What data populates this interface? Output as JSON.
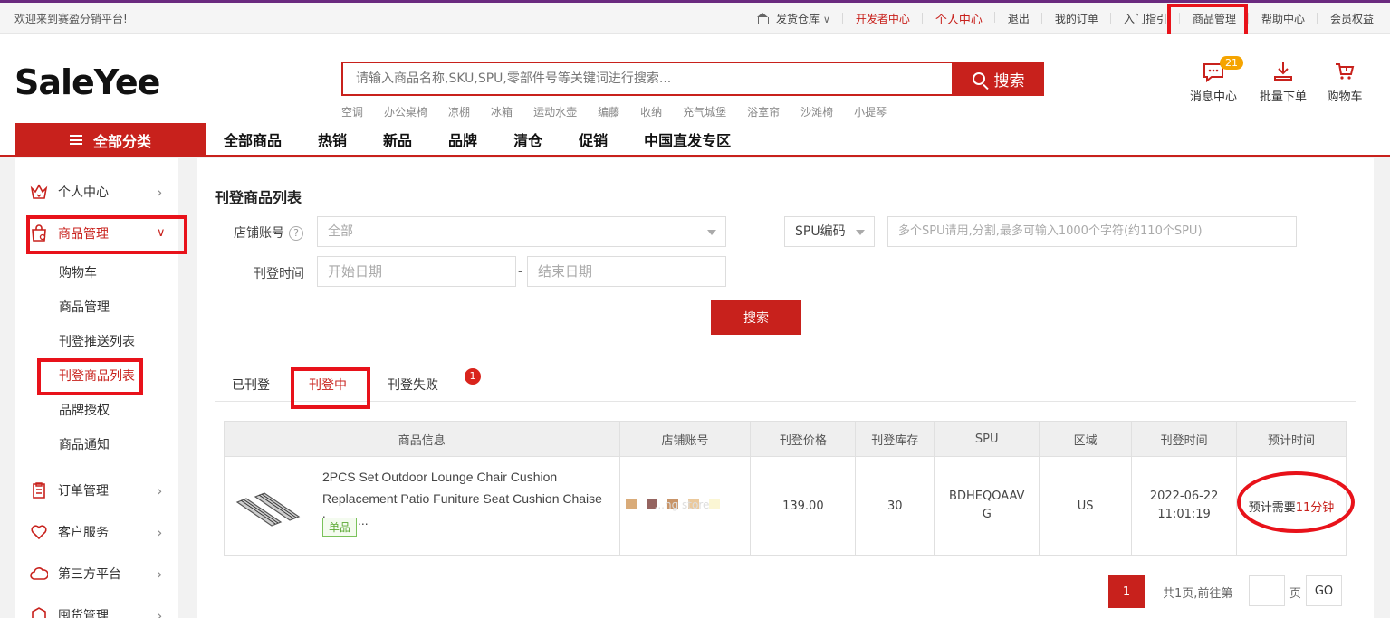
{
  "topbar": {
    "welcome": "欢迎来到赛盈分销平台!",
    "warehouse": "发货仓库",
    "links": [
      "开发者中心",
      "个人中心",
      "退出",
      "我的订单",
      "入门指引",
      "商品管理",
      "帮助中心",
      "会员权益"
    ]
  },
  "header": {
    "logo": "SaleYee",
    "search_placeholder": "请输入商品名称,SKU,SPU,零部件号等关键词进行搜索...",
    "search_button": "搜索",
    "hot_words": [
      "空调",
      "办公桌椅",
      "凉棚",
      "冰箱",
      "运动水壶",
      "编藤",
      "收纳",
      "充气城堡",
      "浴室帘",
      "沙滩椅",
      "小提琴"
    ],
    "messages": {
      "label": "消息中心",
      "badge": "21"
    },
    "bulk_order": "批量下单",
    "cart": "购物车"
  },
  "nav": {
    "all_categories": "全部分类",
    "links": [
      "全部商品",
      "热销",
      "新品",
      "品牌",
      "清仓",
      "促销",
      "中国直发专区"
    ]
  },
  "sidebar": {
    "personal": "个人中心",
    "product_mgmt": "商品管理",
    "sub": [
      "购物车",
      "商品管理",
      "刊登推送列表",
      "刊登商品列表",
      "品牌授权",
      "商品通知"
    ],
    "order_mgmt": "订单管理",
    "customer_service": "客户服务",
    "third_party": "第三方平台",
    "stock_mgmt": "囤货管理"
  },
  "content": {
    "title": "刊登商品列表",
    "store_label": "店铺账号",
    "store_value": "全部",
    "spu_select": "SPU编码",
    "spu_placeholder": "多个SPU请用,分割,最多可输入1000个字符(约110个SPU)",
    "time_label": "刊登时间",
    "start_placeholder": "开始日期",
    "dash": "-",
    "end_placeholder": "结束日期",
    "search_button": "搜索",
    "tabs": [
      "已刊登",
      "刊登中",
      "刊登失败"
    ],
    "fail_badge": "1"
  },
  "table": {
    "headers": [
      "商品信息",
      "店铺账号",
      "刊登价格",
      "刊登库存",
      "SPU",
      "区域",
      "刊登时间",
      "预计时间"
    ],
    "row": {
      "name": "2PCS Set Outdoor Lounge Chair Cushion Replacement Patio Funiture Seat Cushion Chaise Loung...",
      "tag": "单品",
      "store": "...ng store",
      "price": "139.00",
      "stock": "30",
      "spu": "BDHEQOAAVG",
      "region": "US",
      "date": "2022-06-22",
      "time": "11:01:19",
      "est_prefix": "预计需要",
      "est_value": "11分钟"
    }
  },
  "pager": {
    "current": "1",
    "total_text": "共1页,前往第",
    "page_suffix": "页",
    "go": "GO"
  },
  "colors": {
    "brand_red": "#c8211c",
    "highlight_box": "#e8121a",
    "badge_orange": "#f5a400"
  }
}
